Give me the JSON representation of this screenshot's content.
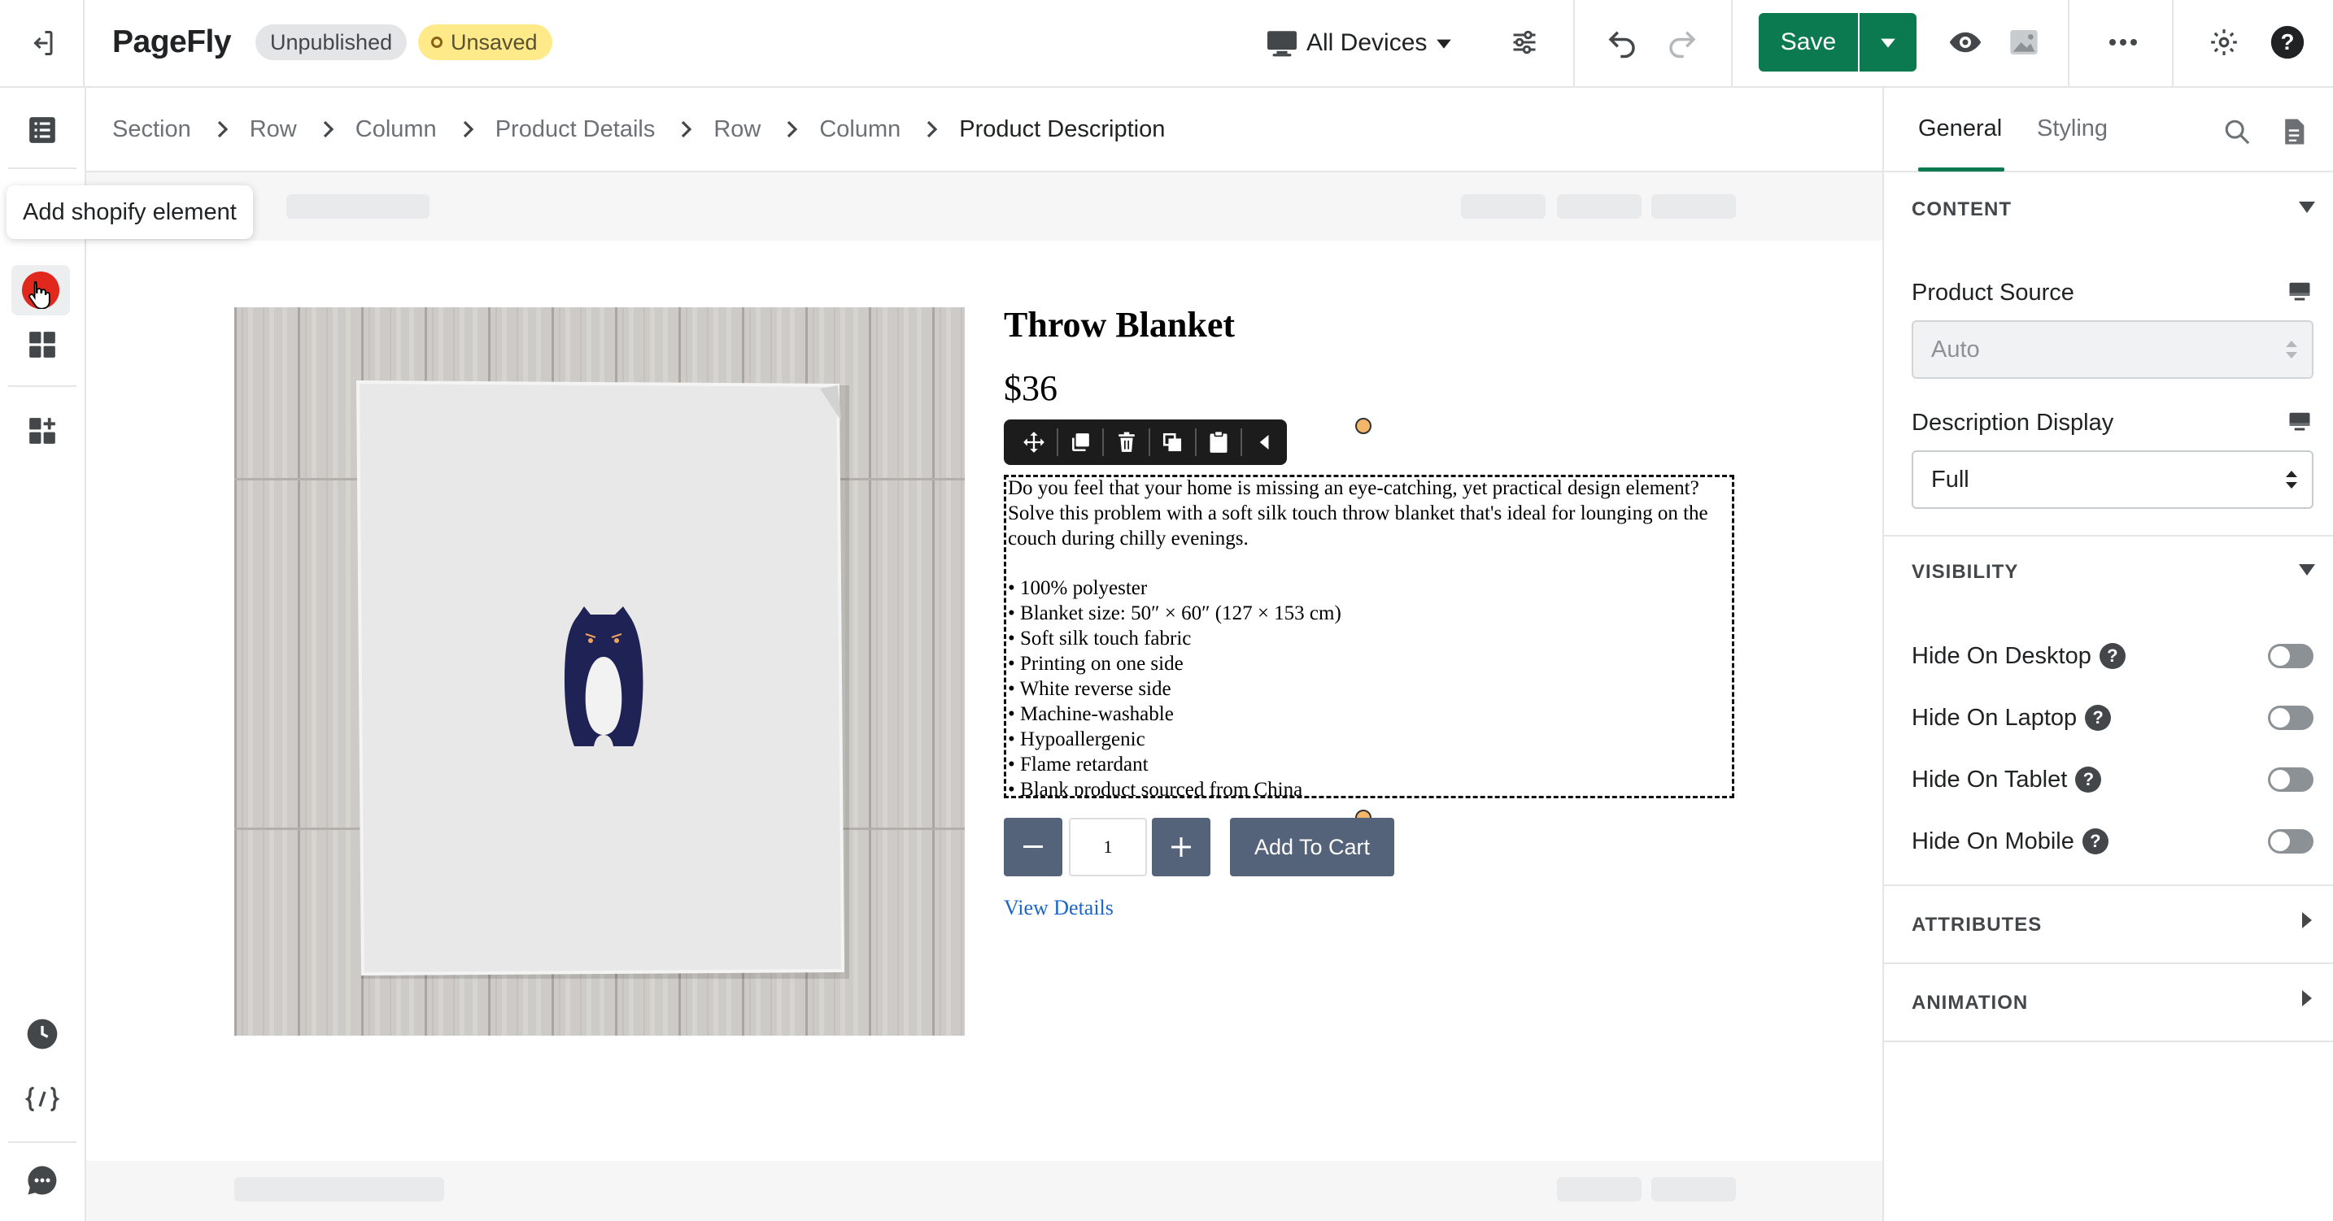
{
  "app": {
    "name": "PageFly",
    "badges": {
      "unpublished": "Unpublished",
      "unsaved": "Unsaved"
    },
    "device_selector": "All Devices",
    "save_label": "Save"
  },
  "tooltip": "Add shopify element",
  "breadcrumb": [
    "Section",
    "Row",
    "Column",
    "Product Details",
    "Row",
    "Column",
    "Product Description"
  ],
  "product": {
    "title": "Throw Blanket",
    "price": "$36",
    "description": "Do you feel that your home is missing an eye-catching, yet practical design element? Solve this problem with a soft silk touch throw blanket that's ideal for lounging on the couch during chilly evenings.",
    "features": [
      "100% polyester",
      "Blanket size: 50″ × 60″ (127 × 153 cm)",
      "Soft silk touch fabric",
      "Printing on one side",
      "White reverse side",
      "Machine-washable",
      "Hypoallergenic",
      "Flame retardant",
      "Blank product sourced from China"
    ],
    "quantity": "1",
    "add_to_cart": "Add To Cart",
    "view_details": "View Details"
  },
  "panel": {
    "tabs": [
      "General",
      "Styling"
    ],
    "active_tab": "General",
    "sections": {
      "content": "CONTENT",
      "visibility": "VISIBILITY",
      "attributes": "ATTRIBUTES",
      "animation": "ANIMATION"
    },
    "product_source": {
      "label": "Product Source",
      "value": "Auto"
    },
    "description_display": {
      "label": "Description Display",
      "value": "Full"
    },
    "visibility_items": [
      "Hide On Desktop",
      "Hide On Laptop",
      "Hide On Tablet",
      "Hide On Mobile"
    ],
    "help_glyph": "?"
  },
  "colors": {
    "brand_green": "#0b7a50",
    "unsaved_badge": "#ffea8a",
    "button_slate": "#54637a",
    "link_blue": "#1b66c9",
    "selected_red": "#e0281d"
  },
  "icons": [
    "exit-icon",
    "devices-icon",
    "sliders-icon",
    "undo-icon",
    "redo-icon",
    "chevron-down-icon",
    "eye-icon",
    "image-icon",
    "more-icon",
    "settings-icon",
    "help-icon",
    "list-icon",
    "grid-icon",
    "add-section-icon",
    "history-icon",
    "code-icon",
    "chat-icon",
    "search-icon",
    "document-icon",
    "move-icon",
    "duplicate-icon",
    "delete-icon",
    "copy-icon",
    "paste-icon",
    "collapse-icon"
  ]
}
